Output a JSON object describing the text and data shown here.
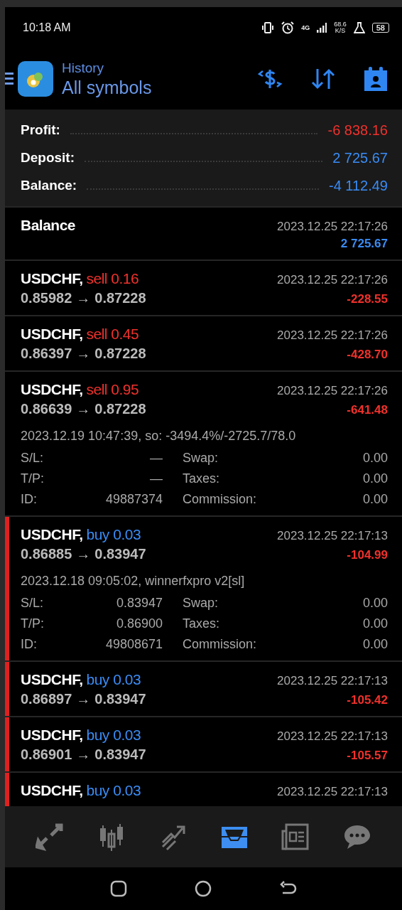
{
  "status_bar": {
    "time": "10:18 AM",
    "network": "4G",
    "speed": "68.6",
    "speed_unit": "K/S",
    "battery": "58"
  },
  "header": {
    "title": "History",
    "subtitle": "All symbols"
  },
  "summary": [
    {
      "label": "Profit:",
      "value": "-6 838.16",
      "color": "#f0312c"
    },
    {
      "label": "Deposit:",
      "value": "2 725.67",
      "color": "#3a8cf5"
    },
    {
      "label": "Balance:",
      "value": "-4 112.49",
      "color": "#3a8cf5"
    }
  ],
  "deals": [
    {
      "kind": "balance",
      "title": "Balance",
      "time": "2023.12.25 22:17:26",
      "amount": {
        "text": "2 725.67",
        "color": "#3a8cf5"
      },
      "marked": false
    },
    {
      "kind": "trade",
      "symbol": "USDCHF,",
      "action": {
        "text": "sell 0.16",
        "color": "#f0312c"
      },
      "open": "0.85982",
      "arrow": "→",
      "close": "0.87228",
      "time": "2023.12.25 22:17:26",
      "amount": {
        "text": "-228.55",
        "color": "#f0312c"
      },
      "marked": false
    },
    {
      "kind": "trade",
      "symbol": "USDCHF,",
      "action": {
        "text": "sell 0.45",
        "color": "#f0312c"
      },
      "open": "0.86397",
      "arrow": "→",
      "close": "0.87228",
      "time": "2023.12.25 22:17:26",
      "amount": {
        "text": "-428.70",
        "color": "#f0312c"
      },
      "marked": false
    },
    {
      "kind": "trade",
      "symbol": "USDCHF,",
      "action": {
        "text": "sell 0.95",
        "color": "#f0312c"
      },
      "open": "0.86639",
      "arrow": "→",
      "close": "0.87228",
      "time": "2023.12.25 22:17:26",
      "amount": {
        "text": "-641.48",
        "color": "#f0312c"
      },
      "marked": false,
      "info": "2023.12.19 10:47:39, so: -3494.4%/-2725.7/78.0",
      "fields": [
        {
          "label": "S/L:",
          "value": "—"
        },
        {
          "label": "Swap:",
          "value": "0.00"
        },
        {
          "label": "T/P:",
          "value": "—"
        },
        {
          "label": "Taxes:",
          "value": "0.00"
        },
        {
          "label": "ID:",
          "value": "49887374"
        },
        {
          "label": "Commission:",
          "value": "0.00"
        }
      ]
    },
    {
      "kind": "trade",
      "symbol": "USDCHF,",
      "action": {
        "text": "buy 0.03",
        "color": "#3a8cf5"
      },
      "open": "0.86885",
      "arrow": "→",
      "close": "0.83947",
      "time": "2023.12.25 22:17:13",
      "amount": {
        "text": "-104.99",
        "color": "#f0312c"
      },
      "marked": true,
      "info": "2023.12.18 09:05:02, winnerfxpro v2[sl]",
      "fields": [
        {
          "label": "S/L:",
          "value": "0.83947"
        },
        {
          "label": "Swap:",
          "value": "0.00"
        },
        {
          "label": "T/P:",
          "value": "0.86900"
        },
        {
          "label": "Taxes:",
          "value": "0.00"
        },
        {
          "label": "ID:",
          "value": "49808671"
        },
        {
          "label": "Commission:",
          "value": "0.00"
        }
      ]
    },
    {
      "kind": "trade",
      "symbol": "USDCHF,",
      "action": {
        "text": "buy 0.03",
        "color": "#3a8cf5"
      },
      "open": "0.86897",
      "arrow": "→",
      "close": "0.83947",
      "time": "2023.12.25 22:17:13",
      "amount": {
        "text": "-105.42",
        "color": "#f0312c"
      },
      "marked": true
    },
    {
      "kind": "trade",
      "symbol": "USDCHF,",
      "action": {
        "text": "buy 0.03",
        "color": "#3a8cf5"
      },
      "open": "0.86901",
      "arrow": "→",
      "close": "0.83947",
      "time": "2023.12.25 22:17:13",
      "amount": {
        "text": "-105.57",
        "color": "#f0312c"
      },
      "marked": true
    },
    {
      "kind": "trade_cut",
      "symbol": "USDCHF,",
      "action": {
        "text": "buy 0.03",
        "color": "#3a8cf5"
      },
      "time": "2023.12.25 22:17:13",
      "marked": true
    }
  ],
  "bottom_nav": [
    {
      "selected": false
    },
    {
      "selected": false
    },
    {
      "selected": false
    },
    {
      "selected": true
    },
    {
      "selected": false
    },
    {
      "selected": false
    }
  ]
}
